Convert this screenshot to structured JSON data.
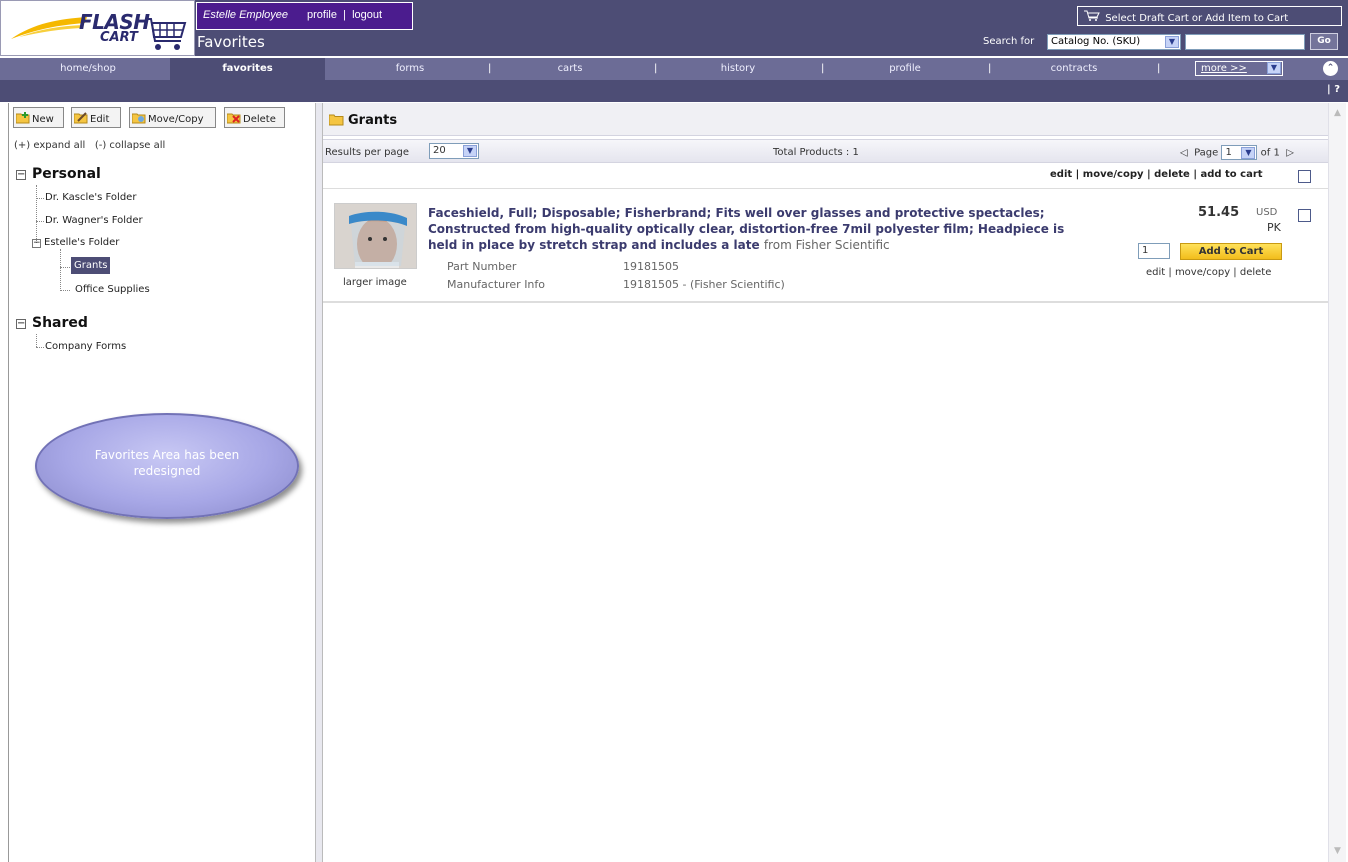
{
  "header": {
    "logo_text_top": "FLASH",
    "logo_text_bottom": "CART",
    "user_name": "Estelle Employee",
    "profile_link": "profile",
    "logout_link": "logout",
    "page_title": "Favorites",
    "cart_button_label": "Select Draft Cart or Add Item to Cart",
    "search_label": "Search for",
    "search_type_value": "Catalog No. (SKU)",
    "search_value": "",
    "go_label": "Go"
  },
  "nav": {
    "tabs": [
      "home/shop",
      "favorites",
      "forms",
      "carts",
      "history",
      "profile",
      "contracts"
    ],
    "active_tab": "favorites",
    "more_label": "more >>",
    "help_label": "?"
  },
  "left_toolbar": {
    "new_label": "New",
    "edit_label": "Edit",
    "move_copy_label": "Move/Copy",
    "delete_label": "Delete"
  },
  "tree": {
    "expand_all": "(+) expand all",
    "collapse_all": "(-) collapse all",
    "personal_label": "Personal",
    "personal_items": [
      "Dr. Kascle's Folder",
      "Dr. Wagner's Folder",
      "Estelle's Folder"
    ],
    "estelle_children": [
      "Grants",
      "Office Supplies"
    ],
    "selected": "Grants",
    "shared_label": "Shared",
    "shared_items": [
      "Company Forms"
    ]
  },
  "callout": {
    "text": "Favorites Area has been redesigned"
  },
  "main": {
    "folder_title": "Grants",
    "results_per_page_label": "Results per page",
    "results_per_page_value": "20",
    "total_products": "Total Products : 1",
    "page_label": "Page",
    "page_value": "1",
    "page_of": "of 1",
    "list_actions": {
      "edit": "edit",
      "move_copy": "move/copy",
      "delete": "delete",
      "add_to_cart": "add to cart"
    }
  },
  "product": {
    "title": "Faceshield, Full; Disposable; Fisherbrand; Fits well over glasses and protective spectacles; Constructed from high-quality optically clear, distortion-free 7mil polyester film; Headpiece is held in place by stretch strap and includes a late",
    "from_text": "from Fisher Scientific",
    "larger_image": "larger image",
    "part_number_label": "Part Number",
    "part_number": "19181505",
    "manufacturer_label": "Manufacturer Info",
    "manufacturer_value": "19181505 - (Fisher Scientific)",
    "price": "51.45",
    "currency": "USD",
    "unit": "PK",
    "quantity": "1",
    "add_to_cart_label": "Add to Cart",
    "actions": {
      "edit": "edit",
      "move_copy": "move/copy",
      "delete": "delete"
    }
  },
  "colors": {
    "header_bg": "#4d4d75",
    "nav_bg": "#6c6c96",
    "user_box_bg": "#4b1c8e",
    "product_title": "#3b3b6e",
    "add_to_cart_bg": "#f2bd1c",
    "callout_bg": "#a7a7e6"
  }
}
